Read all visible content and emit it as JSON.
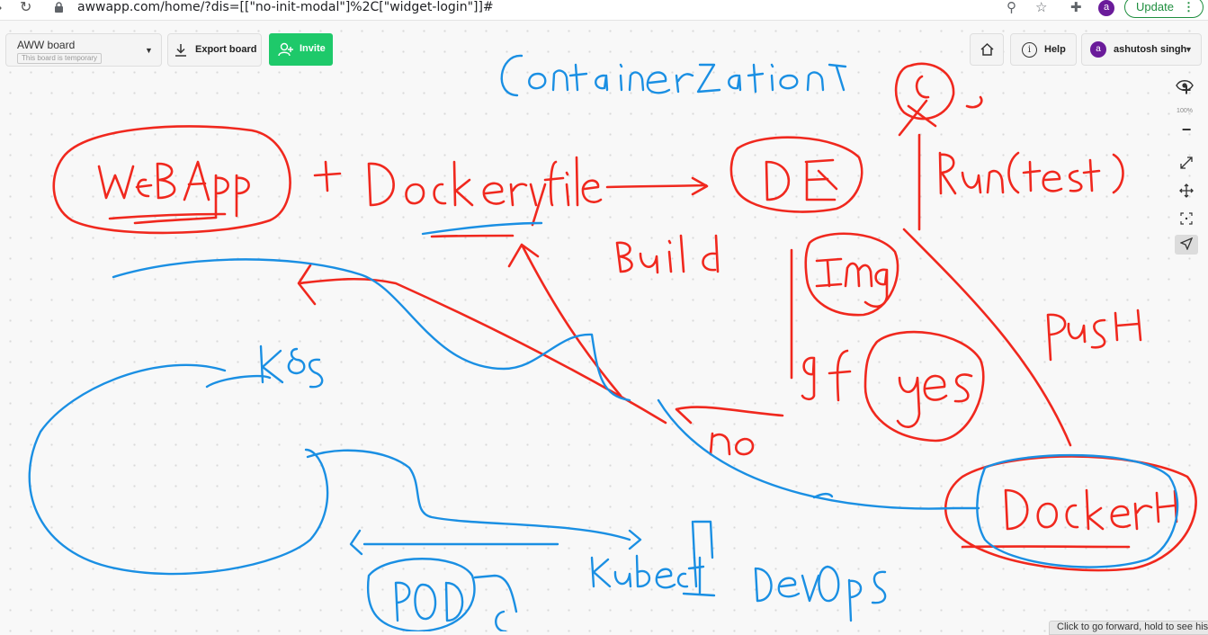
{
  "browser": {
    "url": "awwapp.com/home/?dis=[[\"no-init-modal\"]%2C[\"widget-login\"]]#",
    "profile_initial": "a",
    "update_label": "Update"
  },
  "toolbar": {
    "board_name": "AWW board",
    "board_note": "This board is temporary",
    "export_label": "Export board",
    "invite_label": "Invite",
    "help_label": "Help",
    "user_initial": "a",
    "user_name": "ashutosh singh"
  },
  "side_toolbar": {
    "zoom_level": "100%",
    "icons": [
      "eye-icon",
      "zoom-in-icon",
      "zoom-out-icon",
      "fullscreen-icon",
      "pan-icon",
      "fit-icon",
      "pointer-icon"
    ]
  },
  "status_bar": {
    "text": "Click to go forward, hold to see history"
  },
  "whiteboard": {
    "ink_colors": {
      "red": "#f0281e",
      "blue": "#1a8fe3"
    },
    "handwritten_text": [
      "Containerization",
      "WebApp",
      "+ Dockerfile",
      "DE",
      "Run(test)",
      "Build",
      "Img",
      "If",
      "yes",
      "PUSH",
      "No",
      "DockerHub",
      "K8S",
      "POD",
      "Kubectl",
      "DevOps"
    ]
  }
}
